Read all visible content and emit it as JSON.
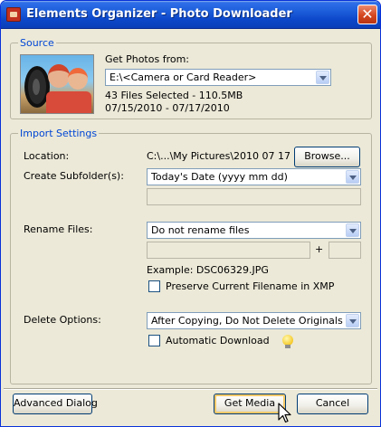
{
  "window": {
    "title": "Elements Organizer - Photo Downloader",
    "close_glyph": "✕"
  },
  "source": {
    "legend": "Source",
    "get_photos_label": "Get Photos from:",
    "device_value": "E:\\<Camera or Card Reader>",
    "files_selected": "43 Files Selected - 110.5MB",
    "date_range": "07/15/2010 - 07/17/2010"
  },
  "import_settings": {
    "legend": "Import Settings",
    "location_label": "Location:",
    "location_value": "C:\\...\\My Pictures\\2010 07 17",
    "browse_label": "Browse...",
    "create_subfolder_label": "Create Subfolder(s):",
    "subfolder_value": "Today's Date (yyyy mm dd)",
    "rename_files_label": "Rename Files:",
    "rename_value": "Do not rename files",
    "plus_sign": "+",
    "example_label": "Example:  DSC06329.JPG",
    "preserve_label": "Preserve Current Filename in XMP",
    "preserve_checked": false,
    "delete_options_label": "Delete Options:",
    "delete_value": "After Copying, Do Not Delete Originals",
    "auto_download_label": "Automatic Download",
    "auto_download_checked": false
  },
  "footer": {
    "advanced_label": "Advanced Dialog",
    "get_media_label": "Get Media",
    "cancel_label": "Cancel"
  }
}
